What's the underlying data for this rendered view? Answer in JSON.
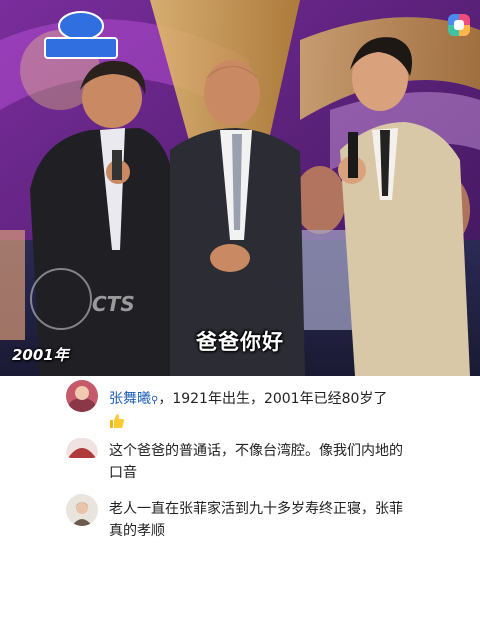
{
  "video": {
    "year_label": "2001年",
    "subtitle": "爸爸你好",
    "watermark": "CTS"
  },
  "comments": [
    {
      "username": "张舞曦",
      "username_icon": "search-icon",
      "text": "，1921年出生，2001年已经80岁了",
      "emoji": "thumbs-up-icon"
    },
    {
      "text": "这个爸爸的普通话，不像台湾腔。像我们内地的口音"
    },
    {
      "text": "老人一直在张菲家活到九十多岁寿终正寝，张菲真的孝顺"
    }
  ]
}
